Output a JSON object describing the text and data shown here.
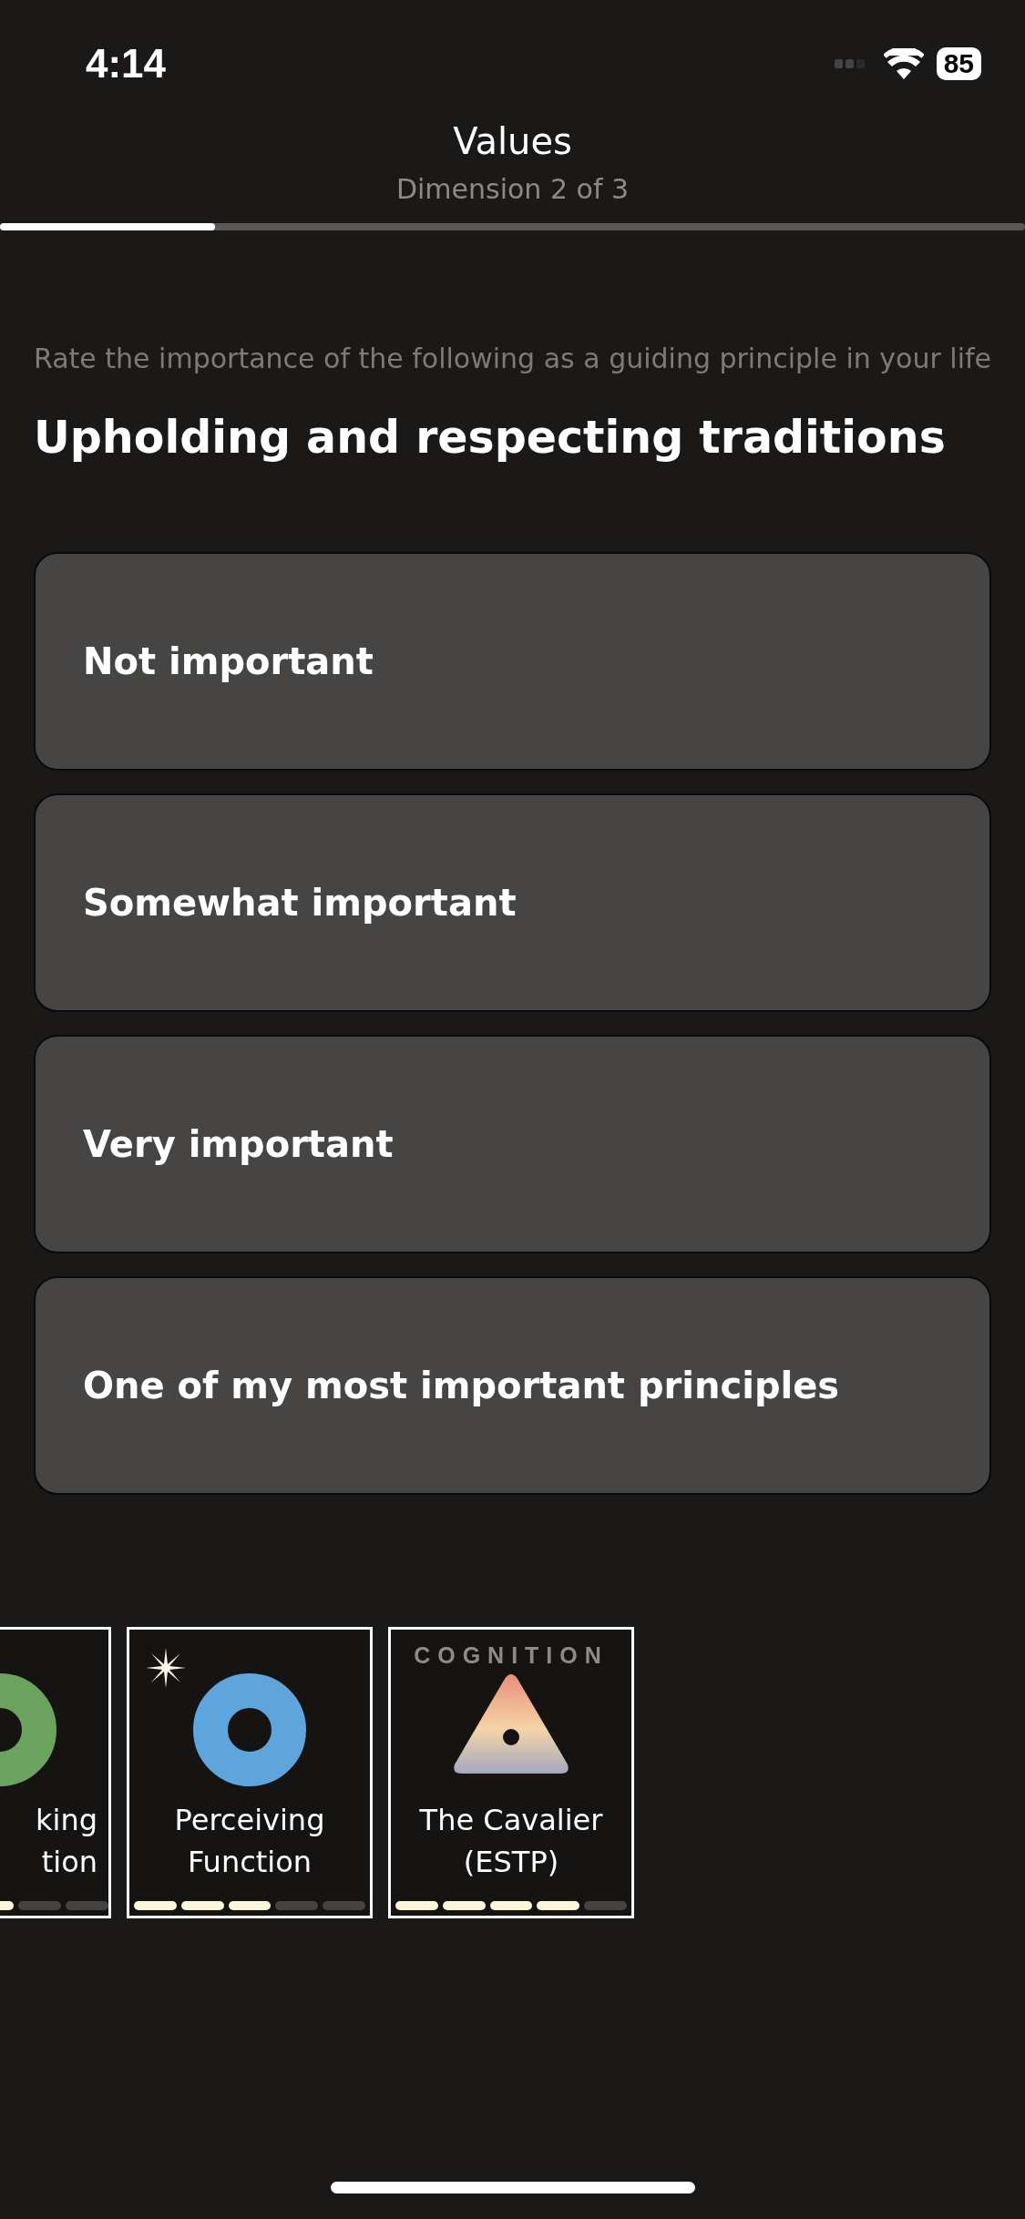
{
  "status_bar": {
    "time": "4:14",
    "battery": "85"
  },
  "header": {
    "title": "Values",
    "subtitle": "Dimension 2 of 3",
    "progress": {
      "level": 0.21
    }
  },
  "prompt": "Rate the importance of the following as a guiding principle in your life",
  "question": "Upholding and respecting traditions",
  "options": [
    {
      "label": "Not important",
      "selected": false
    },
    {
      "label": "Somewhat important",
      "selected": false
    },
    {
      "label": "Very important",
      "selected": false
    },
    {
      "label": "One of my most important principles",
      "selected": false
    }
  ],
  "cards": [
    {
      "kind": "partial",
      "lines": [
        "king",
        "tion"
      ],
      "color": "#6aa35e",
      "level": 0.6
    },
    {
      "kind": "circle",
      "lines": [
        "Perceiving",
        "Function"
      ],
      "color": "#5ea5dd",
      "level": 0.6,
      "starred": true
    },
    {
      "kind": "triangle",
      "category": "COGNITION",
      "lines": [
        "The Cavalier",
        "(ESTP)"
      ],
      "level": 0.8
    }
  ]
}
